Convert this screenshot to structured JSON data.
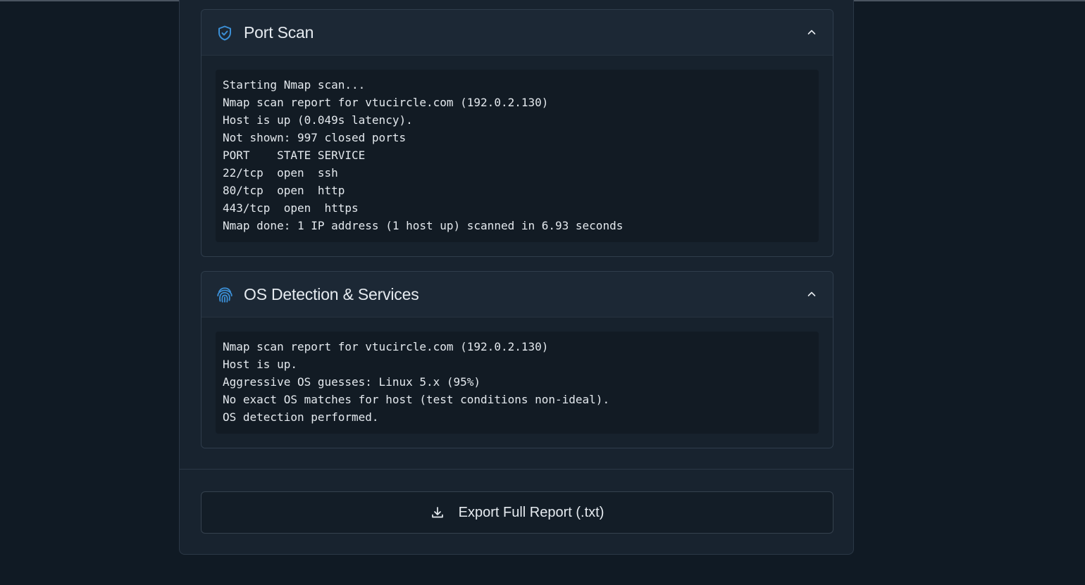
{
  "sections": [
    {
      "title": "Port Scan",
      "icon": "shield-check-icon",
      "lines": [
        "Starting Nmap scan...",
        "Nmap scan report for vtucircle.com (192.0.2.130)",
        "Host is up (0.049s latency).",
        "Not shown: 997 closed ports",
        "PORT    STATE SERVICE",
        "22/tcp  open  ssh",
        "80/tcp  open  http",
        "443/tcp  open  https",
        "Nmap done: 1 IP address (1 host up) scanned in 6.93 seconds"
      ]
    },
    {
      "title": "OS Detection & Services",
      "icon": "fingerprint-icon",
      "lines": [
        "Nmap scan report for vtucircle.com (192.0.2.130)",
        "Host is up.",
        "Aggressive OS guesses: Linux 5.x (95%)",
        "No exact OS matches for host (test conditions non-ideal).",
        "OS detection performed."
      ]
    }
  ],
  "export": {
    "label": "Export Full Report (.txt)",
    "icon": "download-icon"
  },
  "colors": {
    "accent": "#3b8fd6",
    "background": "#101a24",
    "card": "#18232f"
  }
}
